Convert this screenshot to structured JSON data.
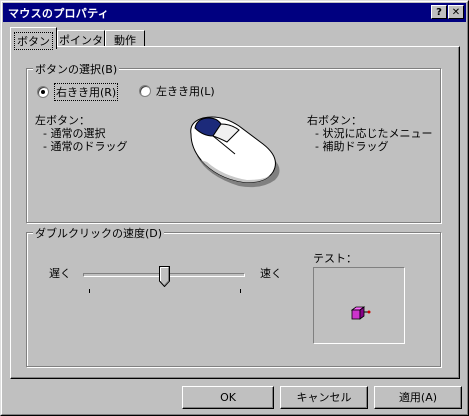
{
  "window": {
    "title": "マウスのプロパティ",
    "help_label": "?",
    "close_label": "✕"
  },
  "tabs": [
    {
      "label": "ボタン",
      "active": true
    },
    {
      "label": "ポインタ",
      "active": false
    },
    {
      "label": "動作",
      "active": false
    }
  ],
  "button_selection": {
    "legend": "ボタンの選択(B)",
    "right_handed": "右きき用(R)",
    "left_handed": "左きき用(L)",
    "selected": "right_handed",
    "left_button": {
      "title": "左ボタン：",
      "line1": "- 通常の選択",
      "line2": "- 通常のドラッグ"
    },
    "right_button": {
      "title": "右ボタン：",
      "line1": "- 状況に応じたメニュー",
      "line2": "- 補助ドラッグ"
    }
  },
  "double_click": {
    "legend": "ダブルクリックの速度(D)",
    "slow_label": "遅く",
    "fast_label": "速く",
    "speed_fraction": 0.5,
    "test_label": "テスト："
  },
  "footer": {
    "ok": "OK",
    "cancel": "キャンセル",
    "apply": "適用(A)"
  },
  "colors": {
    "title_bar": "#000080",
    "mouse_button": "#1c2a7a",
    "test_box": "#cc33cc"
  },
  "icons": {
    "mouse": "mouse-illustration",
    "test": "jack-in-the-box-icon"
  }
}
